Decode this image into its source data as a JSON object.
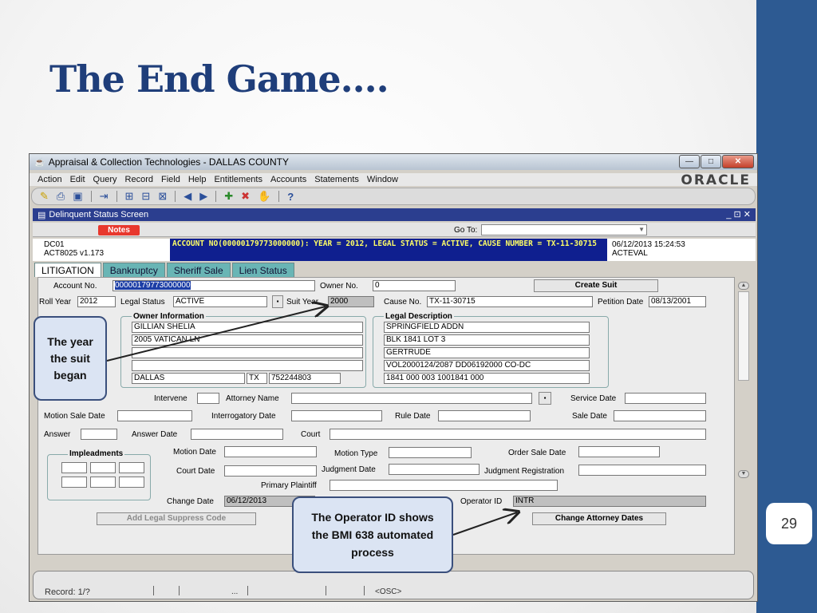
{
  "slide": {
    "title": "The End Game….",
    "page_number": "29"
  },
  "window": {
    "title": "Appraisal & Collection Technologies - DALLAS COUNTY",
    "min_label": "—",
    "max_label": "□",
    "close_label": "✕"
  },
  "menu": {
    "items": [
      "Action",
      "Edit",
      "Query",
      "Record",
      "Field",
      "Help",
      "Entitlements",
      "Accounts",
      "Statements",
      "Window"
    ],
    "brand": "ORACLE"
  },
  "subwindow": {
    "title": "Delinquent Status Screen",
    "controls": "_ ⊡ ✕"
  },
  "notes": {
    "label": "Notes"
  },
  "goto": {
    "label": "Go To:",
    "value": ""
  },
  "info": {
    "code": "DC01",
    "version": "ACT8025  v1.173",
    "banner": "ACCOUNT NO(00000179773000000): YEAR = 2012,  LEGAL STATUS = ACTIVE,  CAUSE NUMBER = TX-11-30715",
    "datetime": "06/12/2013 15:24:53",
    "user": "ACTEVAL"
  },
  "tabs": [
    "LITIGATION",
    "Bankruptcy",
    "Sheriff Sale",
    "Lien Status"
  ],
  "form": {
    "account_no_label": "Account No.",
    "account_no": "00000179773000000",
    "owner_no_label": "Owner No.",
    "owner_no": "0",
    "create_suit": "Create Suit",
    "roll_year_label": "Roll Year",
    "roll_year": "2012",
    "legal_status_label": "Legal Status",
    "legal_status": "ACTIVE",
    "suit_year_label": "Suit Year",
    "suit_year": "2000",
    "cause_no_label": "Cause No.",
    "cause_no": "TX-11-30715",
    "petition_date_label": "Petition Date",
    "petition_date": "08/13/2001",
    "owner_info_title": "Owner Information",
    "owner_lines": [
      "GILLIAN SHELIA",
      "2005 VATICAN LN",
      "",
      ""
    ],
    "owner_city": "DALLAS",
    "owner_state": "TX",
    "owner_zip": "752244803",
    "legal_desc_title": "Legal Description",
    "legal_lines": [
      "SPRINGFIELD ADDN",
      "BLK 1841 LOT 3",
      "GERTRUDE",
      "VOL2000124/2087 DD06192000 CO-DC",
      "1841 000   003          1001841 000"
    ],
    "intervene_label": "Intervene",
    "attorney_name_label": "Attorney Name",
    "service_date_label": "Service Date",
    "motion_sale_date_label": "Motion Sale Date",
    "interrogatory_date_label": "Interrogatory Date",
    "rule_date_label": "Rule Date",
    "sale_date_label": "Sale Date",
    "answer_label": "Answer",
    "answer_date_label": "Answer Date",
    "court_label": "Court",
    "impleadments_title": "Impleadments",
    "motion_date_label": "Motion Date",
    "motion_type_label": "Motion Type",
    "order_sale_date_label": "Order Sale Date",
    "court_date_label": "Court Date",
    "judgment_date_label": "Judgment Date",
    "judgment_registration_label": "Judgment Registration",
    "primary_plaintiff_label": "Primary Plaintiff",
    "change_date_label": "Change Date",
    "change_date": "06/12/2013",
    "operator_id_label": "Operator ID",
    "operator_id": "INTR",
    "add_legal_suppress": "Add Legal Suppress Code",
    "change_attorney_dates": "Change Attorney Dates",
    "lov_button": "▪"
  },
  "status": {
    "record": "Record: 1/?",
    "dots": "...",
    "osc": "<OSC>"
  },
  "callouts": {
    "year": "The year the suit began",
    "operator": "The Operator ID shows the BMI 638 automated process"
  },
  "colors": {
    "slide_title": "#1f3e7a",
    "side_bar": "#2d5a92",
    "banner_bg": "#0f1f8f",
    "banner_text": "#ffff66",
    "tab": "#69b5b5",
    "notes": "#e8382d"
  }
}
